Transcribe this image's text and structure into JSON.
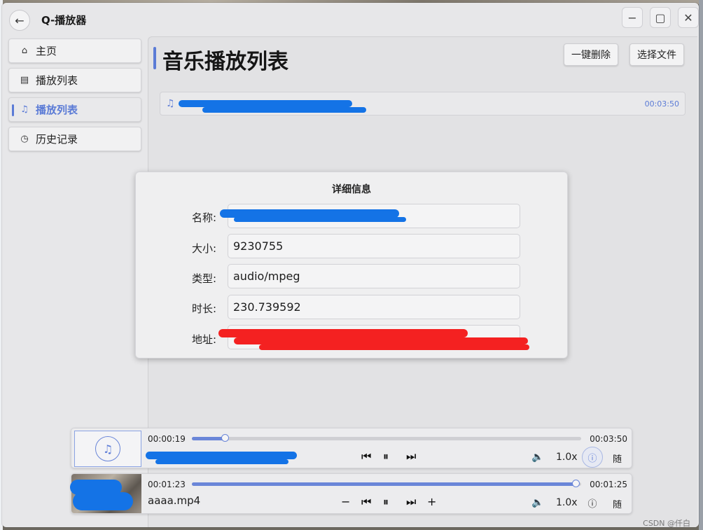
{
  "window": {
    "title": "Q-播放器"
  },
  "titlebar": {
    "back_icon": "←",
    "minimize_icon": "−",
    "maximize_icon": "▢",
    "close_icon": "✕"
  },
  "sidebar": {
    "items": [
      {
        "label": "主页",
        "icon": "home-icon",
        "glyph": "⌂",
        "active": false
      },
      {
        "label": "播放列表",
        "icon": "playlist-icon",
        "glyph": "▤",
        "active": false
      },
      {
        "label": "播放列表",
        "icon": "music-list-icon",
        "glyph": "♫",
        "active": true
      },
      {
        "label": "历史记录",
        "icon": "clock-icon",
        "glyph": "◷",
        "active": false
      }
    ]
  },
  "main": {
    "title": "音乐播放列表",
    "buttons": {
      "delete_all": "一键删除",
      "choose_file": "选择文件"
    },
    "tracks": [
      {
        "duration": "00:03:50"
      }
    ]
  },
  "dialog": {
    "title": "详细信息",
    "fields": [
      {
        "label": "名称:",
        "value": ""
      },
      {
        "label": "大小:",
        "value": "9230755"
      },
      {
        "label": "类型:",
        "value": "audio/mpeg"
      },
      {
        "label": "时长:",
        "value": "230.739592"
      },
      {
        "label": "地址:",
        "value": ""
      }
    ]
  },
  "audio_player": {
    "current_time": "00:00:19",
    "total_time": "00:03:50",
    "progress": 0.085,
    "speed": "1.0x",
    "shuffle": "随"
  },
  "video_player": {
    "current_time": "00:01:23",
    "total_time": "00:01:25",
    "progress": 0.985,
    "filename": "aaaa.mp4",
    "speed": "1.0x",
    "shuffle": "随"
  },
  "watermark": "CSDN @仟白",
  "colors": {
    "accent": "#5b7bd6",
    "background": "#e7e7e9"
  }
}
